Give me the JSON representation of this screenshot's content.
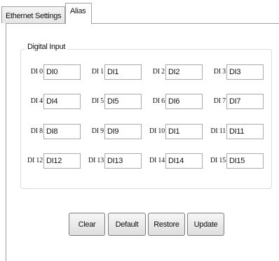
{
  "tabs": {
    "ethernet_settings": "Ethernet Settings",
    "alias": "Alias"
  },
  "group_title": "Digital Input",
  "inputs": [
    {
      "label": "DI 0",
      "value": "DI0"
    },
    {
      "label": "DI 1",
      "value": "DI1"
    },
    {
      "label": "DI 2",
      "value": "DI2"
    },
    {
      "label": "DI 3",
      "value": "DI3"
    },
    {
      "label": "DI 4",
      "value": "DI4"
    },
    {
      "label": "DI 5",
      "value": "DI5"
    },
    {
      "label": "DI 6",
      "value": "DI6"
    },
    {
      "label": "DI 7",
      "value": "DI7"
    },
    {
      "label": "DI 8",
      "value": "DI8"
    },
    {
      "label": "DI 9",
      "value": "DI9"
    },
    {
      "label": "DI 10",
      "value": "DI1"
    },
    {
      "label": "DI 11",
      "value": "DI11"
    },
    {
      "label": "DI 12",
      "value": "DI12"
    },
    {
      "label": "DI 13",
      "value": "DI13"
    },
    {
      "label": "DI 14",
      "value": "DI14"
    },
    {
      "label": "DI 15",
      "value": "DI15"
    }
  ],
  "buttons": {
    "clear": "Clear",
    "default": "Default",
    "restore": "Restore",
    "update": "Update"
  }
}
